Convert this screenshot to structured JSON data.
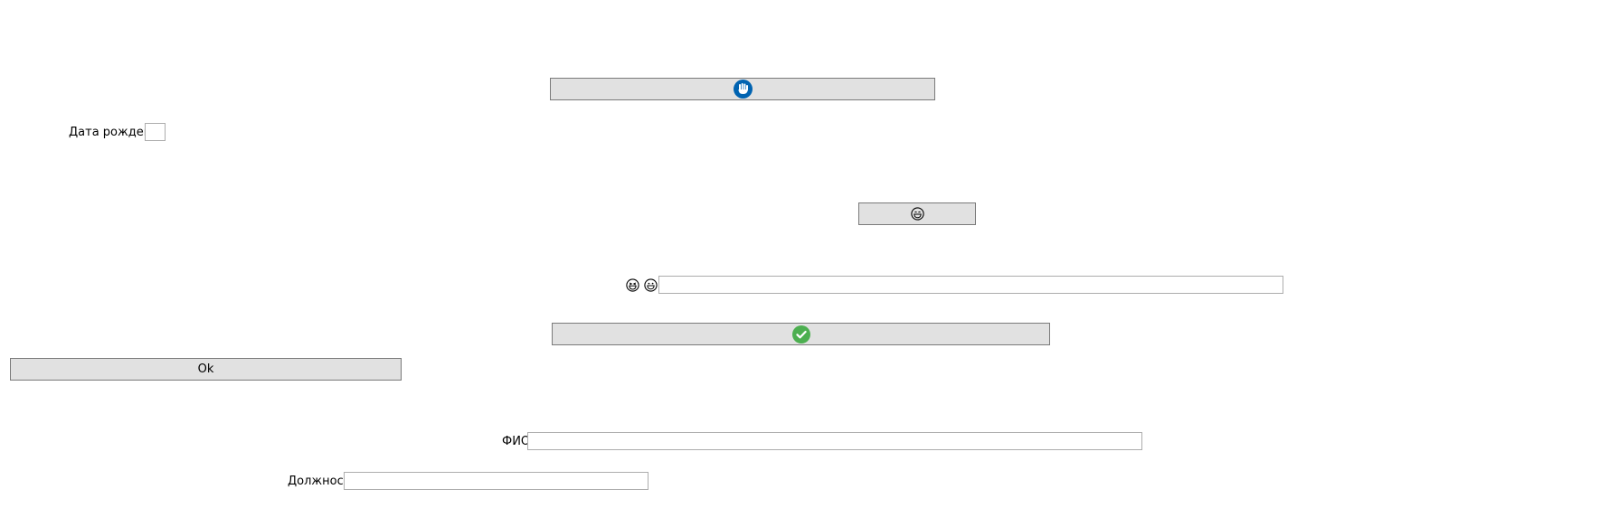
{
  "icons": {
    "top_button": "blue-hand-stop-icon",
    "middle_button": "grinning-face-icon",
    "emoji_left": "grinning-squint-face-icon",
    "emoji_right": "grinning-face-icon",
    "check_button": "green-check-icon"
  },
  "colors": {
    "button_bg": "#e1e1e1",
    "button_border": "#7a7a7a",
    "input_border": "#adadad",
    "blue_icon": "#0063b1",
    "green_icon": "#4caf50"
  },
  "birth_date": {
    "label": "Дата рождения",
    "value": ""
  },
  "emoji_field": {
    "value": ""
  },
  "ok_button": {
    "label": "Ok"
  },
  "fio": {
    "label": "ФИО",
    "value": ""
  },
  "position": {
    "label": "Должность",
    "value": ""
  }
}
